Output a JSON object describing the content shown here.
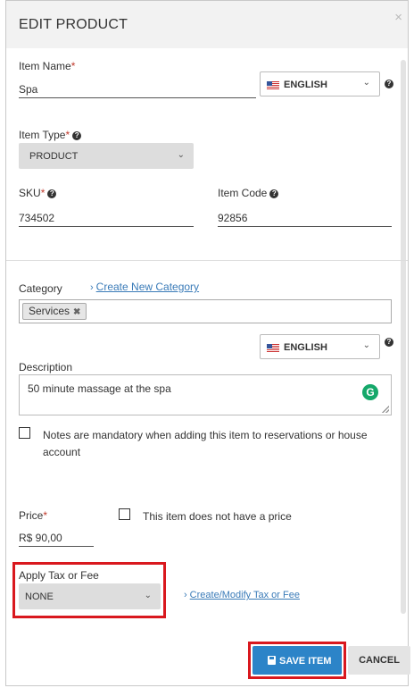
{
  "header": {
    "title": "EDIT PRODUCT",
    "close_glyph": "×"
  },
  "item_name": {
    "label": "Item Name",
    "required_mark": "*",
    "value": "Spa"
  },
  "language_select_1": {
    "value": "ENGLISH",
    "flag": "us-flag-icon"
  },
  "item_type": {
    "label": "Item Type",
    "required_mark": "*",
    "value": "PRODUCT"
  },
  "sku": {
    "label": "SKU",
    "required_mark": "*",
    "value": "734502"
  },
  "item_code": {
    "label": "Item Code",
    "value": "92856"
  },
  "category": {
    "label": "Category",
    "create_link": "Create New Category",
    "tags": [
      {
        "label": "Services",
        "remove_glyph": "✖"
      }
    ]
  },
  "language_select_2": {
    "value": "ENGLISH",
    "flag": "us-flag-icon"
  },
  "description": {
    "label": "Description",
    "value": "50 minute massage at the spa"
  },
  "notes_mandatory": {
    "label": "Notes are mandatory when adding this item to reservations or house account",
    "checked": false
  },
  "price": {
    "label": "Price",
    "required_mark": "*",
    "value": "R$ 90,00"
  },
  "no_price": {
    "label": "This item does not have a price",
    "checked": false
  },
  "tax": {
    "label": "Apply Tax or Fee",
    "value": "NONE",
    "modify_link": "Create/Modify Tax or Fee"
  },
  "footer": {
    "save_label": "SAVE ITEM",
    "cancel_label": "CANCEL"
  },
  "glyphs": {
    "help": "?",
    "caret": "⌄",
    "chevron": "›",
    "grammarly": "G"
  },
  "colors": {
    "primary": "#2c84c8",
    "highlight": "#d9181e",
    "required": "#c0392b",
    "link": "#3a7bb8"
  }
}
